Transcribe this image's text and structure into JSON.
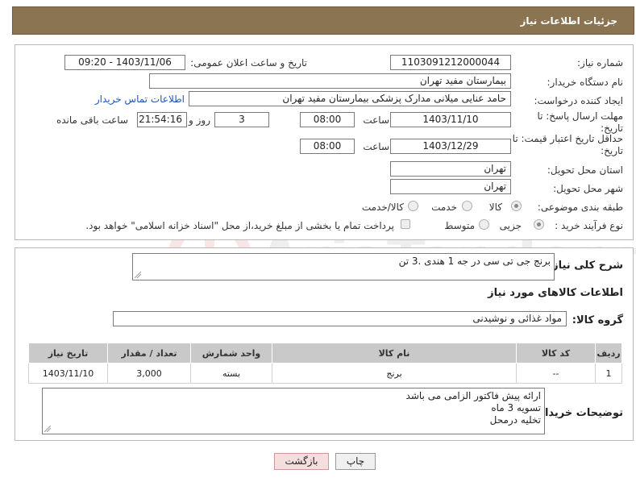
{
  "header": {
    "title": "جزئیات اطلاعات نیاز"
  },
  "form": {
    "need_number_label": "شماره نیاز:",
    "need_number": "1103091212000044",
    "announce_label": "تاریخ و ساعت اعلان عمومی:",
    "announce_value": "1403/11/06 - 09:20",
    "buyer_org_label": "نام دستگاه خریدار:",
    "buyer_org": "بیمارستان مفید تهران",
    "creator_label": "ایجاد کننده درخواست:",
    "creator": "حامد عنایی میلانی مدارک پزشکی بیمارستان مفید تهران",
    "contact_link": "اطلاعات تماس خریدار",
    "deadline_label": "مهلت ارسال پاسخ: تا تاریخ:",
    "deadline_date": "1403/11/10",
    "time_label": "ساعت",
    "deadline_time": "08:00",
    "days": "3",
    "days_label": "روز و",
    "remaining": "21:54:16",
    "remaining_label": "ساعت باقی مانده",
    "validity_label": "حداقل تاریخ اعتبار قیمت: تا تاریخ:",
    "validity_date": "1403/12/29",
    "validity_time": "08:00",
    "province_label": "استان محل تحویل:",
    "province": "تهران",
    "city_label": "شهر محل تحویل:",
    "city": "تهران",
    "category_label": "طبقه بندی موضوعی:",
    "category_options": [
      "کالا",
      "خدمت",
      "کالا/خدمت"
    ],
    "process_label": "نوع فرآیند خرید :",
    "process_options": [
      "جزیی",
      "متوسط"
    ],
    "payment_note": "پرداخت تمام یا بخشی از مبلغ خرید،از محل \"اسناد خزانه اسلامی\" خواهد بود."
  },
  "details": {
    "summary_label": "شرح کلی نیاز:",
    "summary": "برنج جی تی سی در جه 1 هندی .3 تن",
    "goods_info_title": "اطلاعات کالاهای مورد نیاز",
    "group_label": "گروه کالا:",
    "group": "مواد غذائی و نوشیدنی",
    "table_headers": [
      "ردیف",
      "کد کالا",
      "نام کالا",
      "واحد شمارش",
      "تعداد / مقدار",
      "تاریخ نیاز"
    ],
    "table_rows": [
      [
        "1",
        "--",
        "برنج",
        "بسته",
        "3,000",
        "1403/11/10"
      ]
    ],
    "buyer_notes_label": "توضیحات خریدار:",
    "buyer_notes": [
      "ارائه پیش فاکتور الزامی می باشد",
      "تسویه 3 ماه",
      "تخلیه درمحل"
    ]
  },
  "buttons": {
    "print": "چاپ",
    "back": "بازگشت"
  },
  "watermark": {
    "text": "AriaTender.neT"
  },
  "colors": {
    "header": "#8b7451",
    "link": "#1f55b8",
    "back_button": "#f7dede",
    "print_button": "#f0f0f0"
  }
}
